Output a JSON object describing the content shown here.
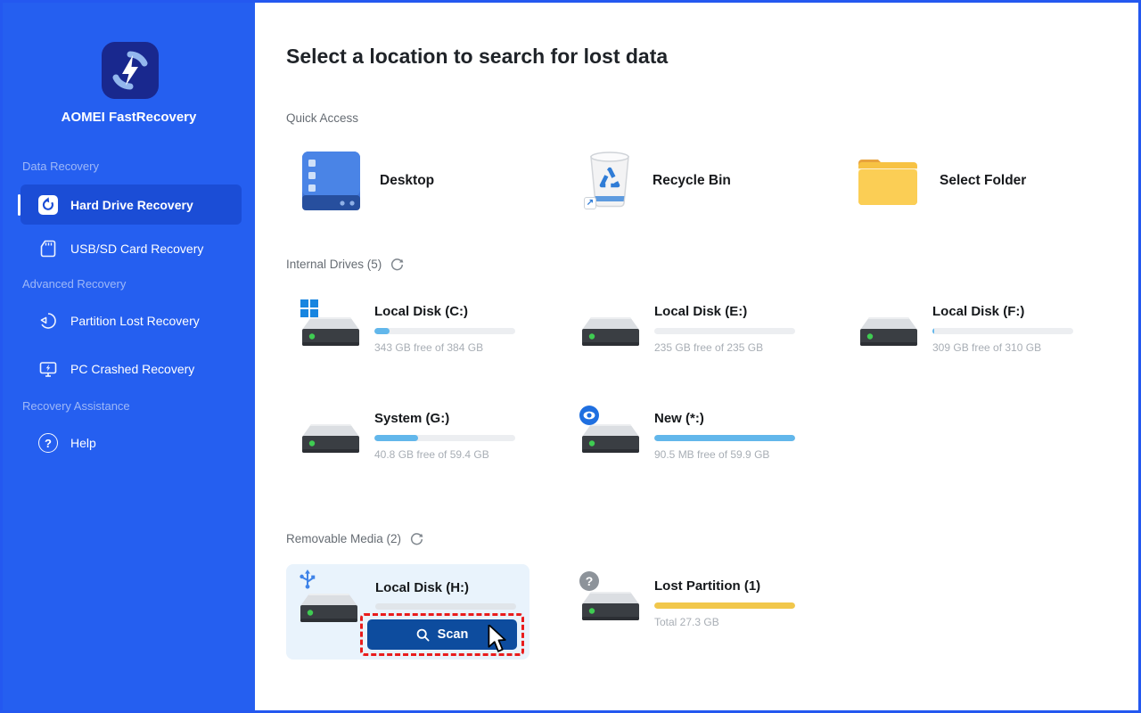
{
  "titlebar": {
    "buttons": [
      "support",
      "menu",
      "minimize",
      "maximize",
      "close"
    ]
  },
  "sidebar": {
    "app_name": "AOMEI FastRecovery",
    "groups": [
      {
        "label": "Data Recovery"
      },
      {
        "label": "Advanced Recovery"
      },
      {
        "label": "Recovery Assistance"
      }
    ],
    "items": [
      {
        "label": "Hard Drive Recovery",
        "active": true
      },
      {
        "label": "USB/SD Card Recovery"
      },
      {
        "label": "Partition Lost Recovery"
      },
      {
        "label": "PC Crashed Recovery"
      },
      {
        "label": "Help"
      }
    ]
  },
  "main": {
    "title": "Select a location to search for lost data",
    "sections": {
      "quick_access": {
        "label": "Quick Access"
      },
      "internal": {
        "label": "Internal Drives (5)"
      },
      "removable": {
        "label": "Removable Media (2)"
      }
    },
    "quick_access_items": [
      {
        "label": "Desktop"
      },
      {
        "label": "Recycle Bin"
      },
      {
        "label": "Select Folder"
      }
    ],
    "internal_drives": [
      {
        "name": "Local Disk (C:)",
        "info": "343 GB free of 384 GB",
        "used_pct": 11
      },
      {
        "name": "Local Disk (E:)",
        "info": "235 GB free of 235 GB",
        "used_pct": 0
      },
      {
        "name": "Local Disk (F:)",
        "info": "309 GB free of 310 GB",
        "used_pct": 1
      },
      {
        "name": "System (G:)",
        "info": "40.8 GB free of 59.4 GB",
        "used_pct": 31
      },
      {
        "name": "New (*:)",
        "info": "90.5 MB free of 59.9 GB",
        "used_pct": 100
      }
    ],
    "removable_drives": [
      {
        "name": "Local Disk (H:)",
        "used_pct": 0,
        "scan_label": "Scan"
      },
      {
        "name": "Lost Partition (1)",
        "info": "Total 27.3 GB",
        "used_pct": 100
      }
    ]
  },
  "icons": {
    "question_mark": "?",
    "help_mark": "?",
    "shortcut_arrow": "↗"
  },
  "colors": {
    "window_border": "#2458f0",
    "sidebar_bg": "#255ff0",
    "sidebar_active_bg": "#1b4dd6",
    "logo_bg": "#19288e",
    "bar_track": "#eceef1",
    "bar_blue": "#62b7eb",
    "bar_yellow": "#f1c74b",
    "scan_button_bg": "#0d4c9e",
    "annotation_red": "#e91c1c",
    "hover_card_bg": "#e9f3fc"
  }
}
